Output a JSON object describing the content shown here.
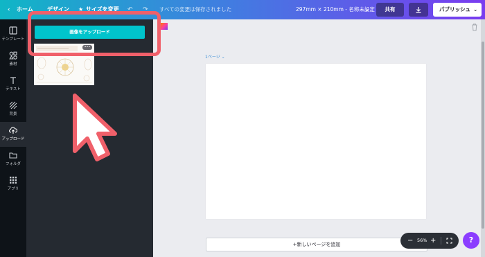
{
  "topbar": {
    "back_label": "ホーム",
    "design_label": "デザイン",
    "resize_label": "サイズを変更",
    "save_status": "すべての変更は保存されました",
    "dimensions": "297mm × 210mm - 名称未設定",
    "share_label": "共有",
    "publish_label": "パブリッシュ"
  },
  "sidebar": {
    "items": [
      {
        "label": "テンプレート",
        "icon": "template-icon"
      },
      {
        "label": "素材",
        "icon": "elements-icon"
      },
      {
        "label": "テキスト",
        "icon": "text-icon"
      },
      {
        "label": "背景",
        "icon": "background-icon"
      },
      {
        "label": "アップロード",
        "icon": "upload-icon"
      },
      {
        "label": "フォルダ",
        "icon": "folder-icon"
      },
      {
        "label": "アプリ",
        "icon": "apps-icon"
      }
    ]
  },
  "panel": {
    "upload_button": "画像をアップロード",
    "thumb_menu": "•••"
  },
  "editor": {
    "page_label": "1ページ",
    "add_page_label": "+新しいページを追加",
    "zoom_value": "56%",
    "help_label": "?"
  },
  "colors": {
    "accent": "#00c4cc",
    "highlight": "#f0606a",
    "help": "#8b3dff"
  }
}
